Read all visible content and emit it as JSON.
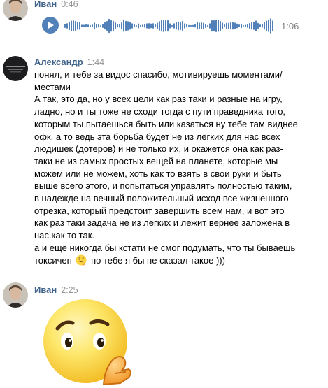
{
  "messages": [
    {
      "author": "Иван",
      "time": "0:46",
      "voice": {
        "duration": "1:06"
      }
    },
    {
      "author": "Александр",
      "time": "1:44",
      "lines": [
        "понял, и тебе за видос спасибо, мотивируешь моментами/",
        "местами",
        "А так, это да, но у всех цели как раз таки и разные на игру,",
        "ладно, но и ты тоже не сходи тогда с пути праведника того,",
        "которым ты пытаешься быть или казаться ну тебе там виднее",
        "офк, а то ведь эта борьба будет не из лёгких для нас всех",
        "людишек (дотеров) и не только их, и окажется она как раз-",
        "таки не из самых простых вещей на планете, которые мы",
        "можем или не можем, хоть как то взять в свои руки и быть",
        "выше всего этого, и попытаться управлять полностью таким,",
        "в надежде на вечный положительный исход все жизненного",
        "отрезка, который предстоит завершить всем нам, и вот это",
        "как раз таки задача не из лёгких и лежит вернее заложена в",
        "нас.как то так.",
        "а и ещё никогда бы кстати не смог подумать, что ты бываешь"
      ],
      "last_line_start": "токсичен",
      "last_line_end": "по тебе я бы не сказал такое )))",
      "inline_emoji": "thinking-face-emoji"
    },
    {
      "author": "Иван",
      "time": "2:25",
      "sticker": "thinking-face-sticker"
    }
  ],
  "colors": {
    "author": "#42648b",
    "time": "#939393",
    "play": "#5181b8",
    "wave": "#5181b8"
  }
}
